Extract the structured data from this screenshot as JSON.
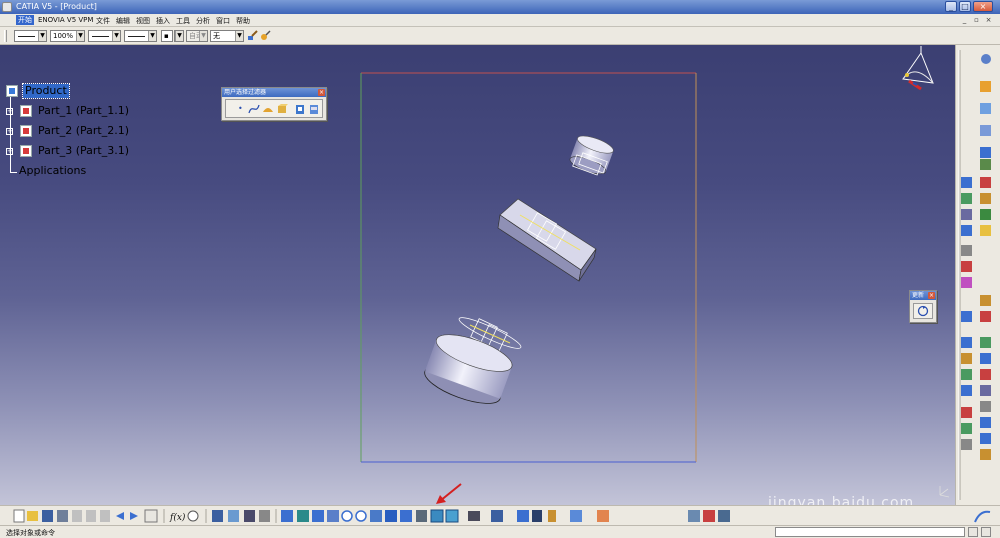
{
  "window": {
    "title": "CATIA V5 - [Product]",
    "minimize": "_",
    "maximize": "□",
    "close": "×"
  },
  "menu": {
    "items": [
      "开始",
      "ENOVIA V5 VPM",
      "文件",
      "编辑",
      "视图",
      "插入",
      "工具",
      "分析",
      "窗口",
      "帮助"
    ]
  },
  "format_toolbar": {
    "zoom_value": "100%",
    "layer_value": "无",
    "number_value": "自动"
  },
  "tree": {
    "root": "Product",
    "children": [
      "Part_1 (Part_1.1)",
      "Part_2 (Part_2.1)",
      "Part_3 (Part_3.1)"
    ],
    "applications": "Applications"
  },
  "panels": {
    "selection_filter_title": "用户选择过滤器",
    "update_title": "更新"
  },
  "status": {
    "message": "选择对象或命令"
  },
  "watermark": "jingyan.baidu.com",
  "colors": {
    "accent": "#3168c8",
    "viewport_top": "#3b3f72",
    "close_red": "#d2583a",
    "arrow_red": "#d42020"
  }
}
